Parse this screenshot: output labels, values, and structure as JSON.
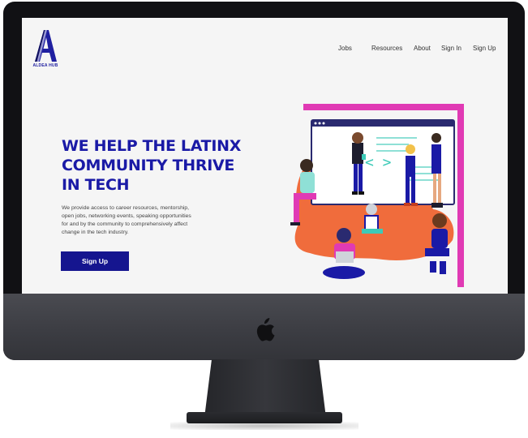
{
  "brand": {
    "logo_letter": "A",
    "logo_text": "ALDEA HUB"
  },
  "nav": [
    {
      "label": "Jobs"
    },
    {
      "label": "Resources"
    },
    {
      "label": "About"
    },
    {
      "label": "Sign In"
    },
    {
      "label": "Sign Up"
    }
  ],
  "hero": {
    "headline_lines": [
      "WE HELP THE LATINX",
      "COMMUNITY THRIVE",
      "IN TECH"
    ],
    "description_lines": [
      "We provide access to career resources, mentorship,",
      "open jobs, networking events, speaking opportunities",
      "for  and by the community  to comprehensively affect",
      "change in the tech industry."
    ],
    "cta_label": "Sign Up",
    "code_glyph": "< >"
  },
  "colors": {
    "accent": "#1a1aa6",
    "button": "#15158f",
    "magenta": "#e03ab4",
    "orange": "#f06c3c",
    "screen_bg": "#f5f5f5"
  },
  "icons": [
    "apple-icon",
    "laptop-icon",
    "phone-icon",
    "code-icon"
  ]
}
